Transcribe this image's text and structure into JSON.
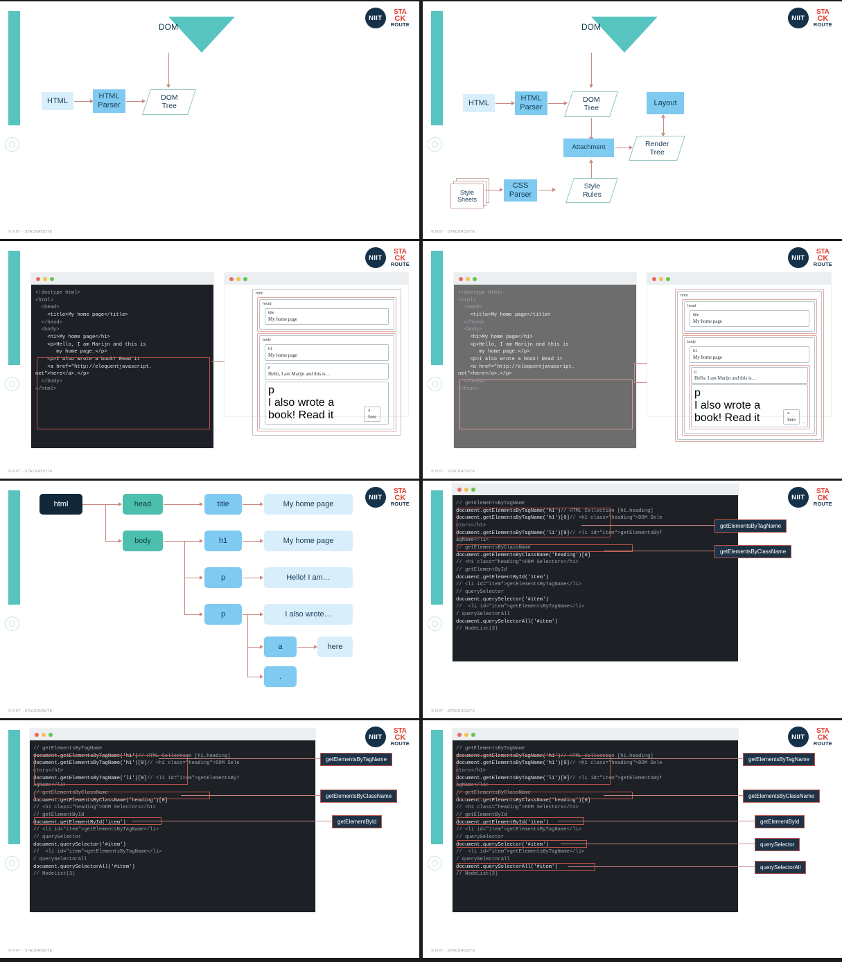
{
  "brand": {
    "badge": "NIIT",
    "stack_top": "STA",
    "stack_mid": "CK",
    "stack_bottom": "ROUTE",
    "footer": "© NIIT - STACKROUTE",
    "accent_teal": "#57c4c0",
    "accent_red": "#c0554b",
    "navy": "#16314a"
  },
  "slide1": {
    "funnel_label": "DOM",
    "nodes": [
      {
        "label": "HTML",
        "type": "pale"
      },
      {
        "label": "HTML\nParser",
        "type": "blue"
      },
      {
        "label": "DOM\nTree",
        "type": "parallelogram"
      }
    ]
  },
  "slide2": {
    "funnel_label": "DOM",
    "nodes": [
      {
        "label": "HTML",
        "type": "pale"
      },
      {
        "label": "HTML\nParser",
        "type": "blue"
      },
      {
        "label": "DOM\nTree",
        "type": "parallelogram"
      },
      {
        "label": "Layout",
        "type": "blue"
      },
      {
        "label": "Attachment",
        "type": "blue"
      },
      {
        "label": "Render\nTree",
        "type": "parallelogram"
      },
      {
        "label": "Style\nSheets",
        "type": "sheets"
      },
      {
        "label": "CSS\nParser",
        "type": "blue"
      },
      {
        "label": "Style\nRules",
        "type": "parallelogram"
      }
    ]
  },
  "html_code": {
    "lines": [
      "<!doctype html>",
      "<html>",
      "  <head>",
      "    <title>My home page</title>",
      "  </head>",
      "  <body>",
      "    <h1>My home page</h1>",
      "    <p>Hello, I am Marijn and this is",
      "       my home page.</p>",
      "    <p>I also wrote a book! Read it",
      "    <a href=\"http://eloquentjavascript.",
      "net\">here</a>.</p>",
      "  </body>",
      "</html>"
    ]
  },
  "dom_preview": {
    "root": "html",
    "head": {
      "name": "head",
      "child": {
        "name": "title",
        "text": "My home page"
      }
    },
    "body": {
      "name": "body",
      "children": [
        {
          "name": "h1",
          "text": "My home page"
        },
        {
          "name": "p",
          "text": "Hello, I am Marijn and this is…"
        },
        {
          "name": "p",
          "text": "I also wrote a book! Read it",
          "anchor": {
            "name": "a",
            "text": "here"
          },
          "tail": "."
        }
      ]
    }
  },
  "tree": {
    "root": "html",
    "head": "head",
    "body": "body",
    "title": "title",
    "title_text": "My home page",
    "h1": "h1",
    "h1_text": "My home page",
    "p1": "p",
    "p1_text": "Hello! I am…",
    "p2": "p",
    "p2_text": "I also wrote…",
    "a": "a",
    "a_text": "here",
    "dot": "."
  },
  "selectors_code": {
    "lines": [
      {
        "t": "// getElementsByTagName",
        "k": "c"
      },
      {
        "t": "document.getElementsByTagName('h1')",
        "k": "d",
        "cm": "// HTML Collection [h1.heading]"
      },
      {
        "t": "document.getElementsByTagName('h1')[0]",
        "k": "d",
        "cm": "// <h1 class=\"heading\">DOM Sele"
      },
      {
        "t": "ctors</h1>",
        "k": "c"
      },
      {
        "t": "document.getElementsByTagName('li')[0]",
        "k": "d",
        "cm": "// <li id=\"item\">getElementsByT"
      },
      {
        "t": "agName</li>",
        "k": "c"
      },
      {
        "t": "// getElementsByClassName",
        "k": "c"
      },
      {
        "t": "document.getElementsByClassName('heading')[0]",
        "k": "d"
      },
      {
        "t": "// <h1 class=\"heading\">DOM Selectors</h1>",
        "k": "c"
      },
      {
        "t": "// getElementById",
        "k": "c"
      },
      {
        "t": "document.getElementById('item')",
        "k": "d"
      },
      {
        "t": "// <li id=\"item\">getElementsByTagName</li>",
        "k": "c"
      },
      {
        "t": "// querySelector",
        "k": "c"
      },
      {
        "t": "document.querySelector('#item')",
        "k": "d"
      },
      {
        "t": "//  <li id=\"item\">getElementsByTagName</li>",
        "k": "c"
      },
      {
        "t": "/ querySelectorAll",
        "k": "c"
      },
      {
        "t": "document.querySelectorAll('#item')",
        "k": "d"
      },
      {
        "t": "// NodeList(3)",
        "k": "c"
      }
    ]
  },
  "callouts": {
    "tagname": "getElementsByTagName",
    "classname": "getElementsByClassName",
    "byid": "getElementById",
    "qs": "querySelector",
    "qsa": "querySelectorAll"
  }
}
